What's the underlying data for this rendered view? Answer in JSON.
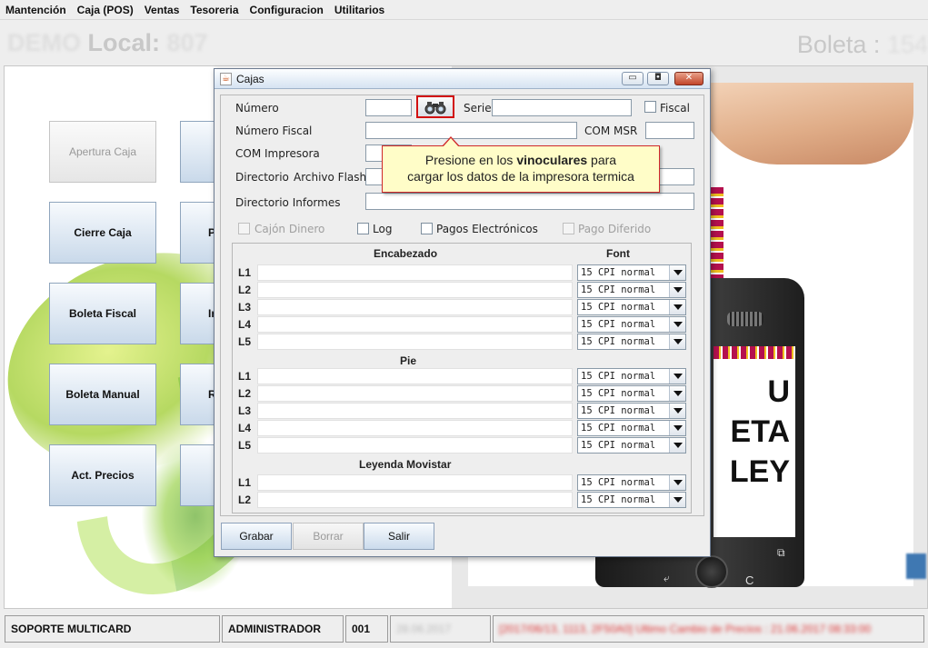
{
  "menubar": {
    "items": [
      "Mantención",
      "Caja (POS)",
      "Ventas",
      "Tesoreria",
      "Configuracion",
      "Utilitarios"
    ]
  },
  "header": {
    "left_blur_a": "DEMO",
    "left_title": "Local:",
    "left_blur_b": "807",
    "right_title": "Boleta :",
    "right_blur": "154"
  },
  "main_buttons": {
    "apertura": "Apertura Caja",
    "cierre": "Cierre Caja",
    "boleta_fiscal": "Boleta Fiscal",
    "boleta_manual": "Boleta Manual",
    "act_precios": "Act. Precios",
    "second_col": [
      "P",
      "In",
      "R"
    ]
  },
  "promo": {
    "screen_lines": [
      "U",
      "ETA",
      "LEY"
    ],
    "key_c": "C",
    "key_back": "⤶",
    "key_k": "⧉"
  },
  "statusbar": {
    "soporte": "SOPORTE MULTICARD",
    "user": "ADMINISTRADOR",
    "code": "001",
    "date_blur": "28.06.2017",
    "msg_blur": "[2017/06/13, 1113, 2F50A0] Ultimo Cambio de Precios : 21.06.2017 08:33:00"
  },
  "dialog": {
    "title": "Cajas",
    "close_glyph": "✕",
    "min_glyph": "▭",
    "max_glyph": "◘",
    "labels": {
      "numero": "Número",
      "serie": "Serie",
      "fiscal": "Fiscal",
      "numero_fiscal": "Número Fiscal",
      "com_msr": "COM MSR",
      "com_impresora": "COM Impresora",
      "directorio": "Directorio",
      "archivo_flash": "Archivo Flash",
      "directorio_informes": "Directorio Informes",
      "cajon_dinero": "Cajón Dinero",
      "log": "Log",
      "pagos_electronicos": "Pagos Electrónicos",
      "pago_diferido": "Pago Diferido"
    },
    "tooltip": {
      "line1_pre": "Presione en los ",
      "line1_bold": "vinoculares",
      "line1_post": " para",
      "line2": "cargar los datos de la impresora termica"
    },
    "sections": {
      "encabezado": "Encabezado",
      "font": "Font",
      "pie": "Pie",
      "leyenda": "Leyenda Movistar"
    },
    "font_default": "15 CPI normal",
    "encabezado_rows": [
      "L1",
      "L2",
      "L3",
      "L4",
      "L5"
    ],
    "pie_rows": [
      "L1",
      "L2",
      "L3",
      "L4",
      "L5"
    ],
    "leyenda_rows": [
      "L1",
      "L2"
    ],
    "buttons": {
      "grabar": "Grabar",
      "borrar": "Borrar",
      "salir": "Salir"
    }
  }
}
